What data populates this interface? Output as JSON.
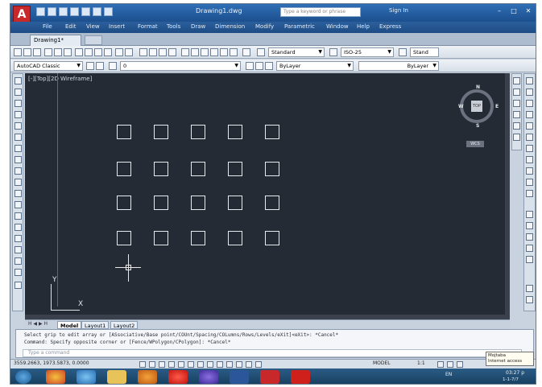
{
  "titlebar": {
    "title": "Drawing1.dwg",
    "search_placeholder": "Type a keyword or phrase",
    "signin": "Sign In"
  },
  "menu": [
    "File",
    "Edit",
    "View",
    "Insert",
    "Format",
    "Tools",
    "Draw",
    "Dimension",
    "Modify",
    "Parametric",
    "Window",
    "Help",
    "Express"
  ],
  "file_tab": "Drawing1*",
  "toolbar1": {
    "text_style": "Standard",
    "dim_style": "ISO-25",
    "table_style": "Stand"
  },
  "toolbar2": {
    "workspace": "AutoCAD Classic",
    "layer": "0",
    "color": "ByLayer",
    "linetype": "ByLayer"
  },
  "viewport_label": "[-][Top][2D Wireframe]",
  "viewcube": {
    "face": "TOP",
    "north": "N",
    "south": "S",
    "east": "E",
    "west": "W",
    "wcs": "WCS"
  },
  "ucs": {
    "x": "X",
    "y": "Y"
  },
  "layout_tabs": [
    "Model",
    "Layout1",
    "Layout2"
  ],
  "nav_arrows": "H ◀ ▶ H",
  "command_history": [
    "Select grip to edit array or [ASsociative/Base point/COUnt/Spacing/COLumns/Rows/Levels/eXit]<eXit>: *Cancel*",
    "Command: Specify opposite corner or [Fence/WPolygon/CPolygon]: *Cancel*"
  ],
  "command_placeholder": "Type a command",
  "status": {
    "coords": "3559.2663, 1973.5873, 0.0000",
    "model": "MODEL",
    "scale": "1:1"
  },
  "tooltip": {
    "line1": "Mojtaba",
    "line2": "Internet access"
  },
  "clock": {
    "time": "03:27 p",
    "date": "1-1-7/7"
  },
  "tray_lang": "EN",
  "colors": {
    "canvas": "#252b35",
    "accent": "#c8282a",
    "taskbar": "#1f4d72",
    "grid": "#e6e9ed"
  }
}
